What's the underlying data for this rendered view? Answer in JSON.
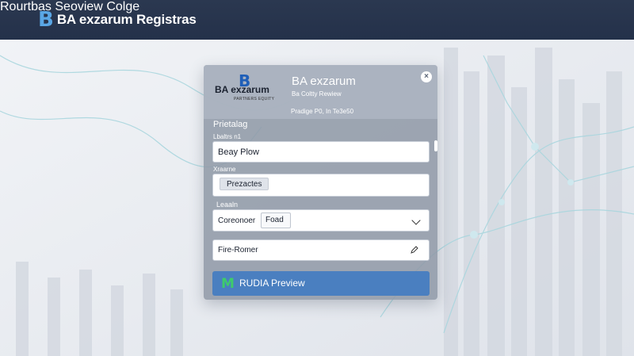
{
  "navbar": {
    "brand_mark": "B",
    "brand_name": "BA exzarum Registras",
    "links": [
      "Rourtbas",
      "Seoview",
      "Colge"
    ]
  },
  "card": {
    "logo_mark": "B",
    "logo_text": "BA exzarum",
    "logo_sub": "PARTNERS EQUITY",
    "title": "BA exzarum",
    "subtitle": "Ba Coltty Rewiew",
    "caption": "Pradige P0, In Te3e50",
    "close_icon": "×",
    "section_label": "Prietalag",
    "field1_label": "Lbaltrs n1",
    "field1_value": "Beay Plow",
    "field2_label": "Xraarne",
    "field2_value": "Prezactes",
    "field3_label": "Leaaln",
    "field3_inner_label": "Coreonoer",
    "field3_value": "Foad",
    "field4_value": "Fire-Romer",
    "button_mark": "M",
    "button_label": "RUDIA  Preview"
  },
  "colors": {
    "navbar": "#24314a",
    "accent": "#4a7fc0",
    "brand_blue": "#5aa7e6",
    "button_logo": "#3ecb6b"
  }
}
